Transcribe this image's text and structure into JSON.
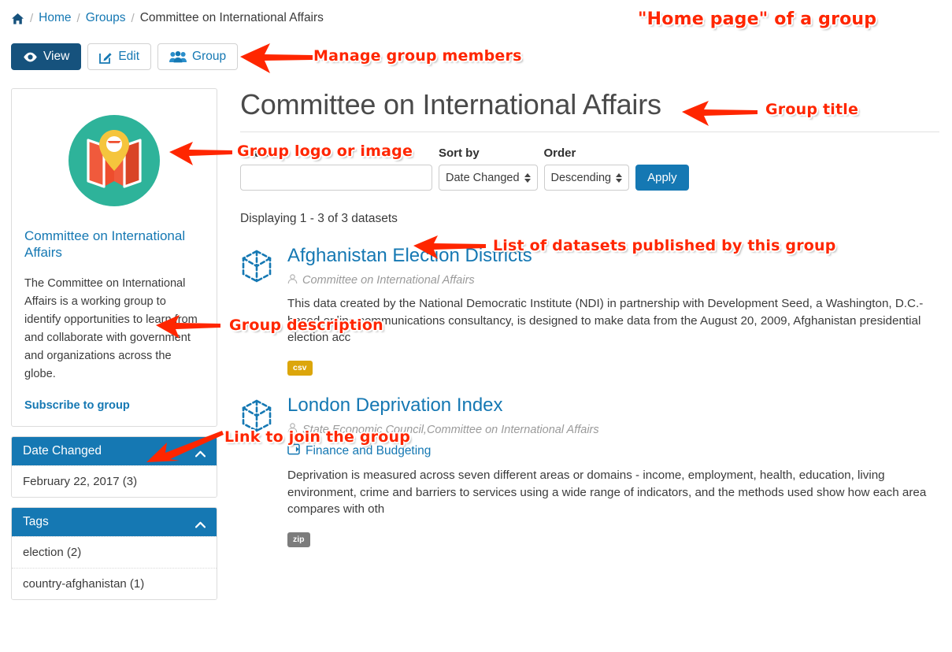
{
  "breadcrumb": {
    "home_icon": "home-icon",
    "items": [
      {
        "label": "Home",
        "link": true
      },
      {
        "label": "Groups",
        "link": true
      },
      {
        "label": "Committee on International Affairs",
        "link": false
      }
    ],
    "separator": "/"
  },
  "toolbar": {
    "view_label": "View",
    "edit_label": "Edit",
    "group_label": "Group"
  },
  "sidebar": {
    "logo_alt": "group-logo-map-pin",
    "group_name": "Committee on International Affairs",
    "description": "The Committee on International Affairs is a working group to identify opportunities to learn from and collaborate with government and organizations across the globe.",
    "subscribe_label": "Subscribe to group",
    "facets": [
      {
        "title": "Date Changed",
        "collapsed": false,
        "items": [
          {
            "label": "February 22, 2017 (3)"
          }
        ]
      },
      {
        "title": "Tags",
        "collapsed": false,
        "items": [
          {
            "label": "election (2)"
          },
          {
            "label": "country-afghanistan (1)"
          }
        ]
      }
    ]
  },
  "main": {
    "title": "Committee on International Affairs",
    "search": {
      "label": "Search",
      "value": "",
      "placeholder": ""
    },
    "sort": {
      "label": "Sort by",
      "selected": "Date Changed"
    },
    "order": {
      "label": "Order",
      "selected": "Descending"
    },
    "apply_label": "Apply",
    "result_count": "Displaying 1 - 3 of 3 datasets",
    "datasets": [
      {
        "title": "Afghanistan Election Districts",
        "author": "Committee on International Affairs",
        "group": null,
        "notes": "This data created by the National Democratic Institute (NDI) in partnership with Development Seed, a Washington, D.C.-based online communications consultancy, is designed to make data from the August 20, 2009, Afghanistan presidential election acc",
        "formats": [
          {
            "label": "csv",
            "color": "#dca60b"
          }
        ]
      },
      {
        "title": "London Deprivation Index",
        "author": "State Economic Council,Committee on International Affairs",
        "group": "Finance and Budgeting",
        "notes": "Deprivation is measured across seven different areas or domains - income, employment, health, education, living environment, crime and barriers to services using a wide range of indicators, and the methods used show how each area compares with oth",
        "formats": [
          {
            "label": "zip",
            "color": "#7c7c7c"
          }
        ]
      }
    ]
  },
  "annotations": [
    {
      "id": "home-page-of-group",
      "text": "\"Home page\" of a group"
    },
    {
      "id": "manage-group-members",
      "text": "Manage group members"
    },
    {
      "id": "group-title",
      "text": "Group title"
    },
    {
      "id": "group-logo-or-image",
      "text": "Group logo or image"
    },
    {
      "id": "group-description",
      "text": "Group description"
    },
    {
      "id": "list-of-datasets",
      "text": "List of datasets published by this group"
    },
    {
      "id": "link-to-join-group",
      "text": "Link to join the group"
    }
  ],
  "colors": {
    "link": "#1578b3",
    "primary_button": "#16527d",
    "facet_header": "#1578b3",
    "annotation": "#ff2600",
    "logo_circle": "#2eb39a",
    "logo_map": "#ee5b3a",
    "logo_pin": "#f5c53d"
  }
}
